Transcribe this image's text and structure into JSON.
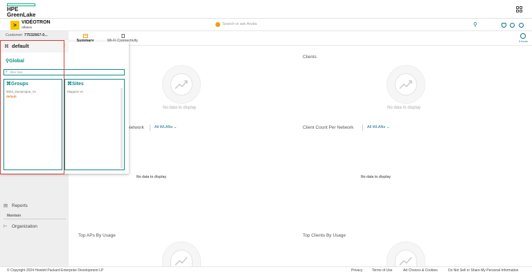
{
  "hpe": {
    "line1": "HPE",
    "line2": "GreenLake"
  },
  "brand": {
    "badge": ">",
    "name": "VIDÉOTRON",
    "sub": "Affaires"
  },
  "search": {
    "placeholder": "Search or ask Aruba"
  },
  "customer": {
    "label": "Customer:",
    "value": "77532667-0..."
  },
  "tabs": [
    {
      "label": "Summary",
      "icon": "summary-icon",
      "active": true
    },
    {
      "label": "Wi-Fi Connectivity",
      "icon": "mobile-icon",
      "active": false
    }
  ],
  "time_range": "3 hours",
  "context": {
    "selected": "default",
    "global_label": "Global",
    "filter_placeholder": "filter lists",
    "groups": {
      "title": "Groups",
      "items": [
        "9004_Dynamique_VL",
        "default"
      ],
      "selected": "default"
    },
    "sites": {
      "title": "Sites",
      "items": [
        "Magasin VL"
      ]
    }
  },
  "sidebar": {
    "reports": "Reports",
    "maintain": "Maintain",
    "organization": "Organization"
  },
  "cards": {
    "clients_title": "Clients",
    "no_data": "No data to display",
    "network_title_partial": "Network",
    "client_count_title": "Client Count Per Network",
    "wlan_filter": "All WLANs",
    "no_data_bold": "No data to display",
    "top_aps_title": "Top APs By Usage",
    "top_clients_title": "Top Clients By Usage"
  },
  "footer": {
    "copyright": "© Copyright 2024 Hewlett Packard Enterprise Development LP",
    "privacy": "Privacy",
    "terms": "Terms of Use",
    "ad_choices": "Ad Choices & Cookies",
    "do_not_sell": "Do Not Sell or Share My Personal Information"
  },
  "colors": {
    "accent": "#0a8a8a",
    "brand_yellow": "#f7c600",
    "highlight": "#e0392b",
    "tab_active": "#f39c12"
  }
}
